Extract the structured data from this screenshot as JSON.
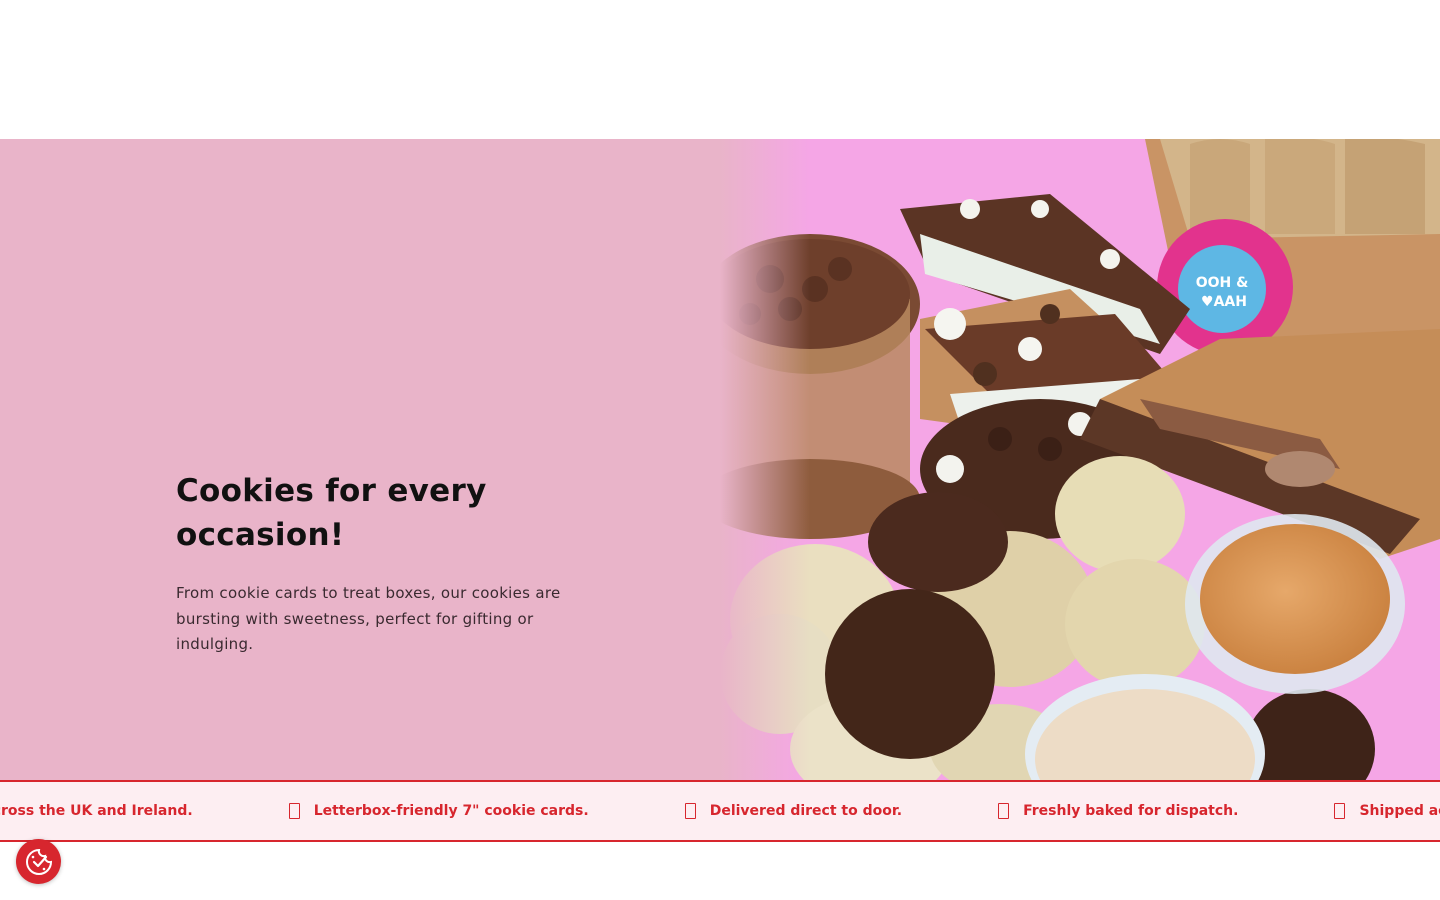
{
  "hero": {
    "title": "Cookies for every occasion!",
    "description": "From cookie cards to treat boxes, our cookies are bursting with sweetness, perfect for gifting or indulging.",
    "image_icon": "cookies-photo",
    "sticker_text": "OOH & AAH"
  },
  "marquee": {
    "items": [
      "Shipped across the UK and Ireland.",
      "Letterbox-friendly 7\" cookie cards.",
      "Delivered direct to door.",
      "Freshly baked for dispatch.",
      "Shipped across the UK and Ireland."
    ],
    "icon": "box-icon"
  },
  "consent": {
    "icon": "cookie-consent-icon"
  },
  "colors": {
    "hero_bg": "#e9b4c9",
    "accent": "#d7262e",
    "marquee_bg": "#fdeef2"
  }
}
